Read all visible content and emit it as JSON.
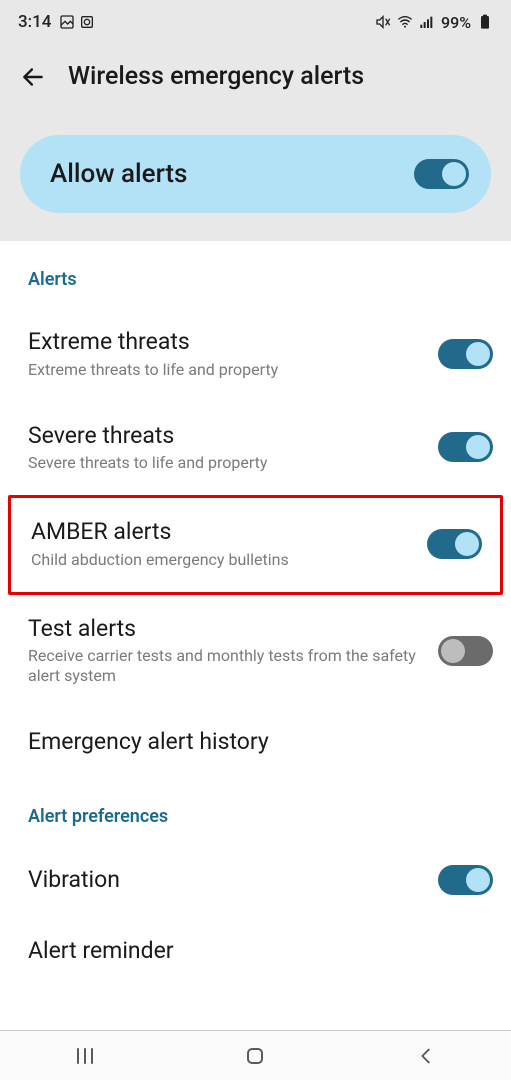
{
  "status": {
    "time": "3:14",
    "battery": "99%"
  },
  "header": {
    "title": "Wireless emergency alerts"
  },
  "allow": {
    "label": "Allow alerts",
    "on": true
  },
  "sections": {
    "alerts_header": "Alerts",
    "prefs_header": "Alert preferences"
  },
  "items": {
    "extreme": {
      "title": "Extreme threats",
      "sub": "Extreme threats to life and property",
      "on": true
    },
    "severe": {
      "title": "Severe threats",
      "sub": "Severe threats to life and property",
      "on": true
    },
    "amber": {
      "title": "AMBER alerts",
      "sub": "Child abduction emergency bulletins",
      "on": true
    },
    "test": {
      "title": "Test alerts",
      "sub": "Receive carrier tests and monthly tests from the safety alert system",
      "on": false
    },
    "history": {
      "title": "Emergency alert history"
    },
    "vibration": {
      "title": "Vibration",
      "on": true
    },
    "reminder": {
      "title": "Alert reminder"
    }
  }
}
